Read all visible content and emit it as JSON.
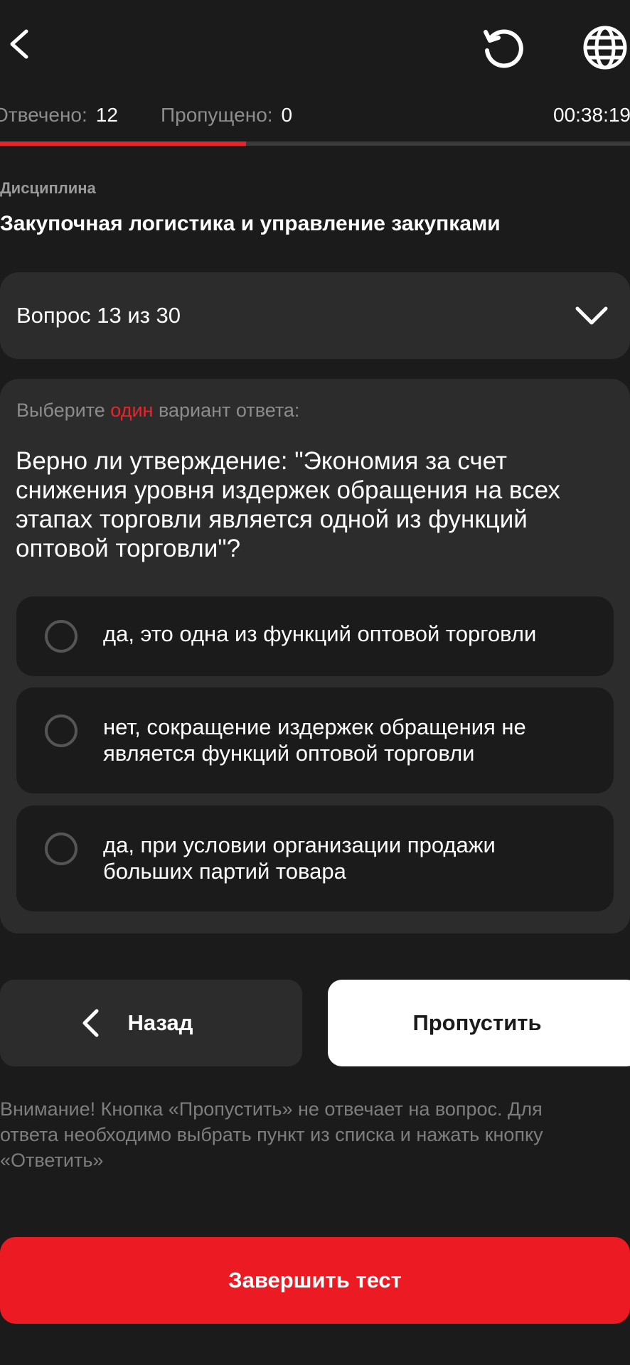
{
  "header": {
    "back_icon": "chevron-left-icon",
    "reset_icon": "refresh-icon",
    "language_icon": "globe-icon"
  },
  "stats": {
    "answered_label": "Отвечено:",
    "answered_value": "12",
    "skipped_label": "Пропущено:",
    "skipped_value": "0",
    "timer": "00:38:19"
  },
  "progress": {
    "fraction": 0.39,
    "fill_color": "#e8252b"
  },
  "discipline": {
    "label": "Дисциплина",
    "title": "Закупочная логистика и управление закупками"
  },
  "question_selector": {
    "label": "Вопрос 13 из 30",
    "icon": "chevron-down-icon"
  },
  "question": {
    "hint_before": "Выберите ",
    "hint_accent": "один",
    "hint_after": " вариант ответа:",
    "text": "Верно ли утверждение: \"Экономия за счет снижения уровня издержек обращения на всех этапах торговли является одной из функций оптовой торговли\"?",
    "options": [
      {
        "label": "да, это одна из функций оптовой торговли",
        "selected": false
      },
      {
        "label": "нет, сокращение издержек обращения не является функций оптовой торговли",
        "selected": false
      },
      {
        "label": "да, при условии организации продажи больших партий товара",
        "selected": false
      }
    ]
  },
  "buttons": {
    "back_label": "Назад",
    "skip_label": "Пропустить",
    "finish_label": "Завершить тест"
  },
  "notice": "Внимание! Кнопка «Пропустить» не отвечает на вопрос. Для ответа необходимо выбрать пункт из списка и нажать кнопку «Ответить»",
  "colors": {
    "background": "#1b1b1b",
    "card": "#2c2c2c",
    "accent": "#ec1a23",
    "muted_text": "#8c8c8c"
  }
}
